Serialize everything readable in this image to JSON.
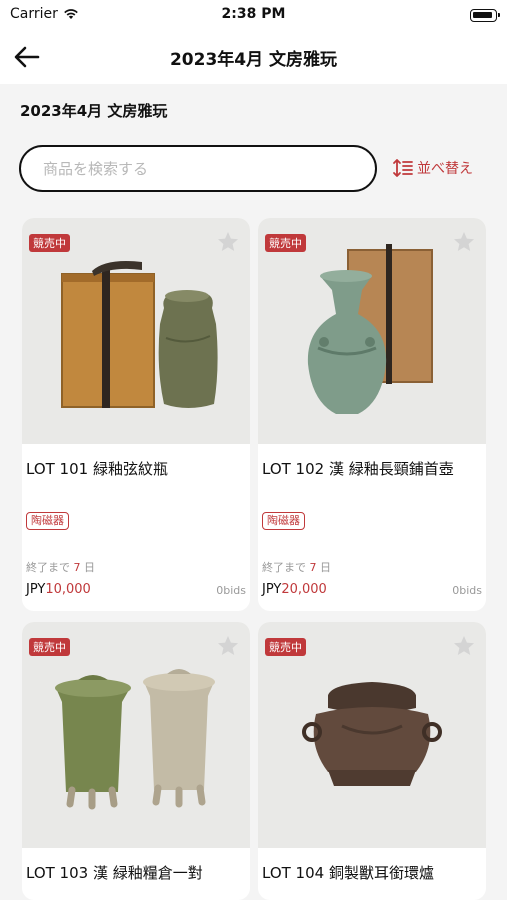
{
  "status_bar": {
    "carrier": "Carrier",
    "time": "2:38 PM"
  },
  "header": {
    "title": "2023年4月 文房雅玩"
  },
  "section": {
    "title": "2023年4月 文房雅玩"
  },
  "search": {
    "placeholder": "商品を検索する",
    "value": ""
  },
  "sort": {
    "label": "並べ替え"
  },
  "colors": {
    "accent": "#c0393b",
    "text": "#111111",
    "muted": "#999999",
    "background": "#f4f4f4"
  },
  "lots": [
    {
      "badge": "競売中",
      "title": "LOT 101 緑釉弦紋瓶",
      "category": "陶磁器",
      "ends_prefix": "終了まで ",
      "ends_days": "7",
      "ends_suffix": " 日",
      "currency": "JPY",
      "price": "10,000",
      "bids": "0bids"
    },
    {
      "badge": "競売中",
      "title": "LOT 102 漢 緑釉長頸鋪首壺",
      "category": "陶磁器",
      "ends_prefix": "終了まで ",
      "ends_days": "7",
      "ends_suffix": " 日",
      "currency": "JPY",
      "price": "20,000",
      "bids": "0bids"
    },
    {
      "badge": "競売中",
      "title": "LOT 103 漢 緑釉糧倉一對"
    },
    {
      "badge": "競売中",
      "title": "LOT 104 銅製獸耳銜環爐"
    }
  ]
}
